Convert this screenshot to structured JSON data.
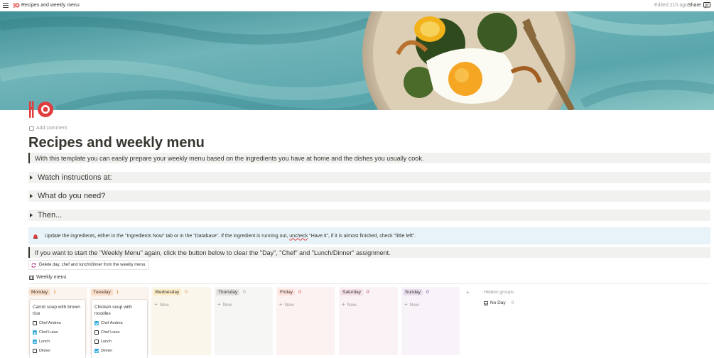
{
  "topbar": {
    "breadcrumb": "Recipes and weekly menu",
    "edited": "Edited 21h ago",
    "share": "Share"
  },
  "page": {
    "add_comment": "Add comment",
    "title": "Recipes and weekly menu",
    "intro": "With this template you can easily prepare your weekly menu based on the ingredients you have at home and the dishes you usually cook.",
    "toggles": [
      "Watch instructions at:",
      "What do you need?",
      "Then..."
    ],
    "callout": {
      "before": "Update the ingredients, either in the \"Ingredients Now\" tab or in the \"Database\". If the ingredient is running out, ",
      "uncheck": "uncheck",
      "after": " \"Have it\", if it is almost finished, check \"little left\"."
    },
    "restart_note": "If you want to start the \"Weekly Menu\" again, click the button below to clear the \"Day\", \"Chef\" and \"Lunch/Dinner\" assignment.",
    "clear_button": "Delete day, chef and lunch/dinner from the weekly menu",
    "db_title": "Weekly menu"
  },
  "board": {
    "columns": [
      {
        "day": "Monday",
        "count": "1",
        "pill_bg": "#fadec9",
        "col_bg": "#fbf3ee",
        "count_color": "#d9730d"
      },
      {
        "day": "Tuesday",
        "count": "1",
        "pill_bg": "#fadec9",
        "col_bg": "#fbf3ee",
        "count_color": "#d9730d"
      },
      {
        "day": "Wednesday",
        "count": "0",
        "pill_bg": "#fdecc8",
        "col_bg": "#fbf6ec",
        "count_color": "#cb912f"
      },
      {
        "day": "Thursday",
        "count": "0",
        "pill_bg": "#e3e2e0",
        "col_bg": "#f6f6f5",
        "count_color": "#9b9a97"
      },
      {
        "day": "Friday",
        "count": "0",
        "pill_bg": "#ffe2dd",
        "col_bg": "#fbf2f1",
        "count_color": "#e03e3e"
      },
      {
        "day": "Saturday",
        "count": "0",
        "pill_bg": "#f5e0e9",
        "col_bg": "#fbf2f5",
        "count_color": "#ad1a72"
      },
      {
        "day": "Sunday",
        "count": "0",
        "pill_bg": "#e8deee",
        "col_bg": "#f8f3f9",
        "count_color": "#6940a5"
      }
    ],
    "new_label": "New",
    "cards": [
      {
        "title": "Carrot soup with brown rice",
        "options": [
          {
            "label": "Chef Andrea",
            "checked": false
          },
          {
            "label": "Chef Luisa",
            "checked": true
          },
          {
            "label": "Lunch",
            "checked": true
          },
          {
            "label": "Dinner",
            "checked": false
          }
        ]
      },
      {
        "title": "Chicken soup with noodles",
        "options": [
          {
            "label": "Chef Andrea",
            "checked": true
          },
          {
            "label": "Chef Luisa",
            "checked": false
          },
          {
            "label": "Lunch",
            "checked": false
          },
          {
            "label": "Dinner",
            "checked": true
          }
        ]
      }
    ],
    "hidden_groups": "Hidden groups",
    "no_day": "No Day",
    "no_day_count": "0"
  },
  "colors": {
    "accent": "#e03e3e",
    "callout_bg": "#e7f3f8",
    "quote_bg": "#f1f1ef",
    "checkbox_on": "#2eaadc"
  },
  "icons": {
    "page_icon": "fork-knife-plate-icon",
    "callout_icon": "alarm-light-icon",
    "button_icon": "refresh-icon",
    "db_icon": "board-icon",
    "no_day_icon": "inbox-icon"
  }
}
